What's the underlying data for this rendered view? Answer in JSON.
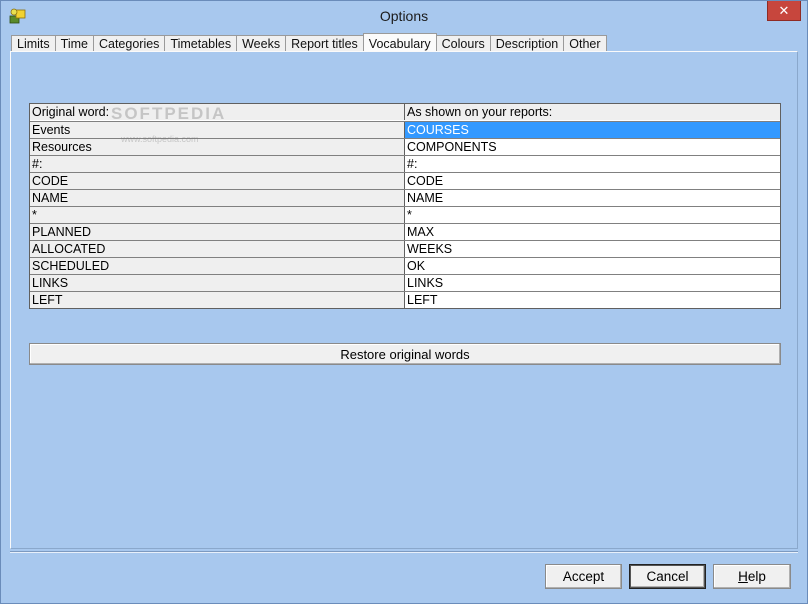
{
  "window": {
    "title": "Options",
    "close_glyph": "✕"
  },
  "tabs": [
    {
      "label": "Limits",
      "active": false
    },
    {
      "label": "Time",
      "active": false
    },
    {
      "label": "Categories",
      "active": false
    },
    {
      "label": "Timetables",
      "active": false
    },
    {
      "label": "Weeks",
      "active": false
    },
    {
      "label": "Report titles",
      "active": false
    },
    {
      "label": "Vocabulary",
      "active": true
    },
    {
      "label": "Colours",
      "active": false
    },
    {
      "label": "Description",
      "active": false
    },
    {
      "label": "Other",
      "active": false
    }
  ],
  "vocabulary": {
    "header": {
      "original": "Original word:",
      "shown": "As shown on your reports:"
    },
    "rows": [
      {
        "original": "Events",
        "shown": "COURSES",
        "selected": true
      },
      {
        "original": "Resources",
        "shown": "COMPONENTS"
      },
      {
        "original": "#:",
        "shown": "#:"
      },
      {
        "original": "CODE",
        "shown": "CODE"
      },
      {
        "original": "NAME",
        "shown": "NAME"
      },
      {
        "original": "*",
        "shown": "*"
      },
      {
        "original": "PLANNED",
        "shown": "MAX"
      },
      {
        "original": "ALLOCATED",
        "shown": "WEEKS"
      },
      {
        "original": "SCHEDULED",
        "shown": "OK"
      },
      {
        "original": "LINKS",
        "shown": "LINKS"
      },
      {
        "original": "LEFT",
        "shown": "LEFT"
      }
    ],
    "restore_label": "Restore original words"
  },
  "watermark": {
    "text": "SOFTPEDIA",
    "sub": "www.softpedia.com"
  },
  "buttons": {
    "accept": "Accept",
    "cancel": "Cancel",
    "help_underlined": "H",
    "help_rest": "elp"
  },
  "colors": {
    "background": "#a8c8ee",
    "selection": "#3399ff",
    "close_button": "#c7463d"
  }
}
